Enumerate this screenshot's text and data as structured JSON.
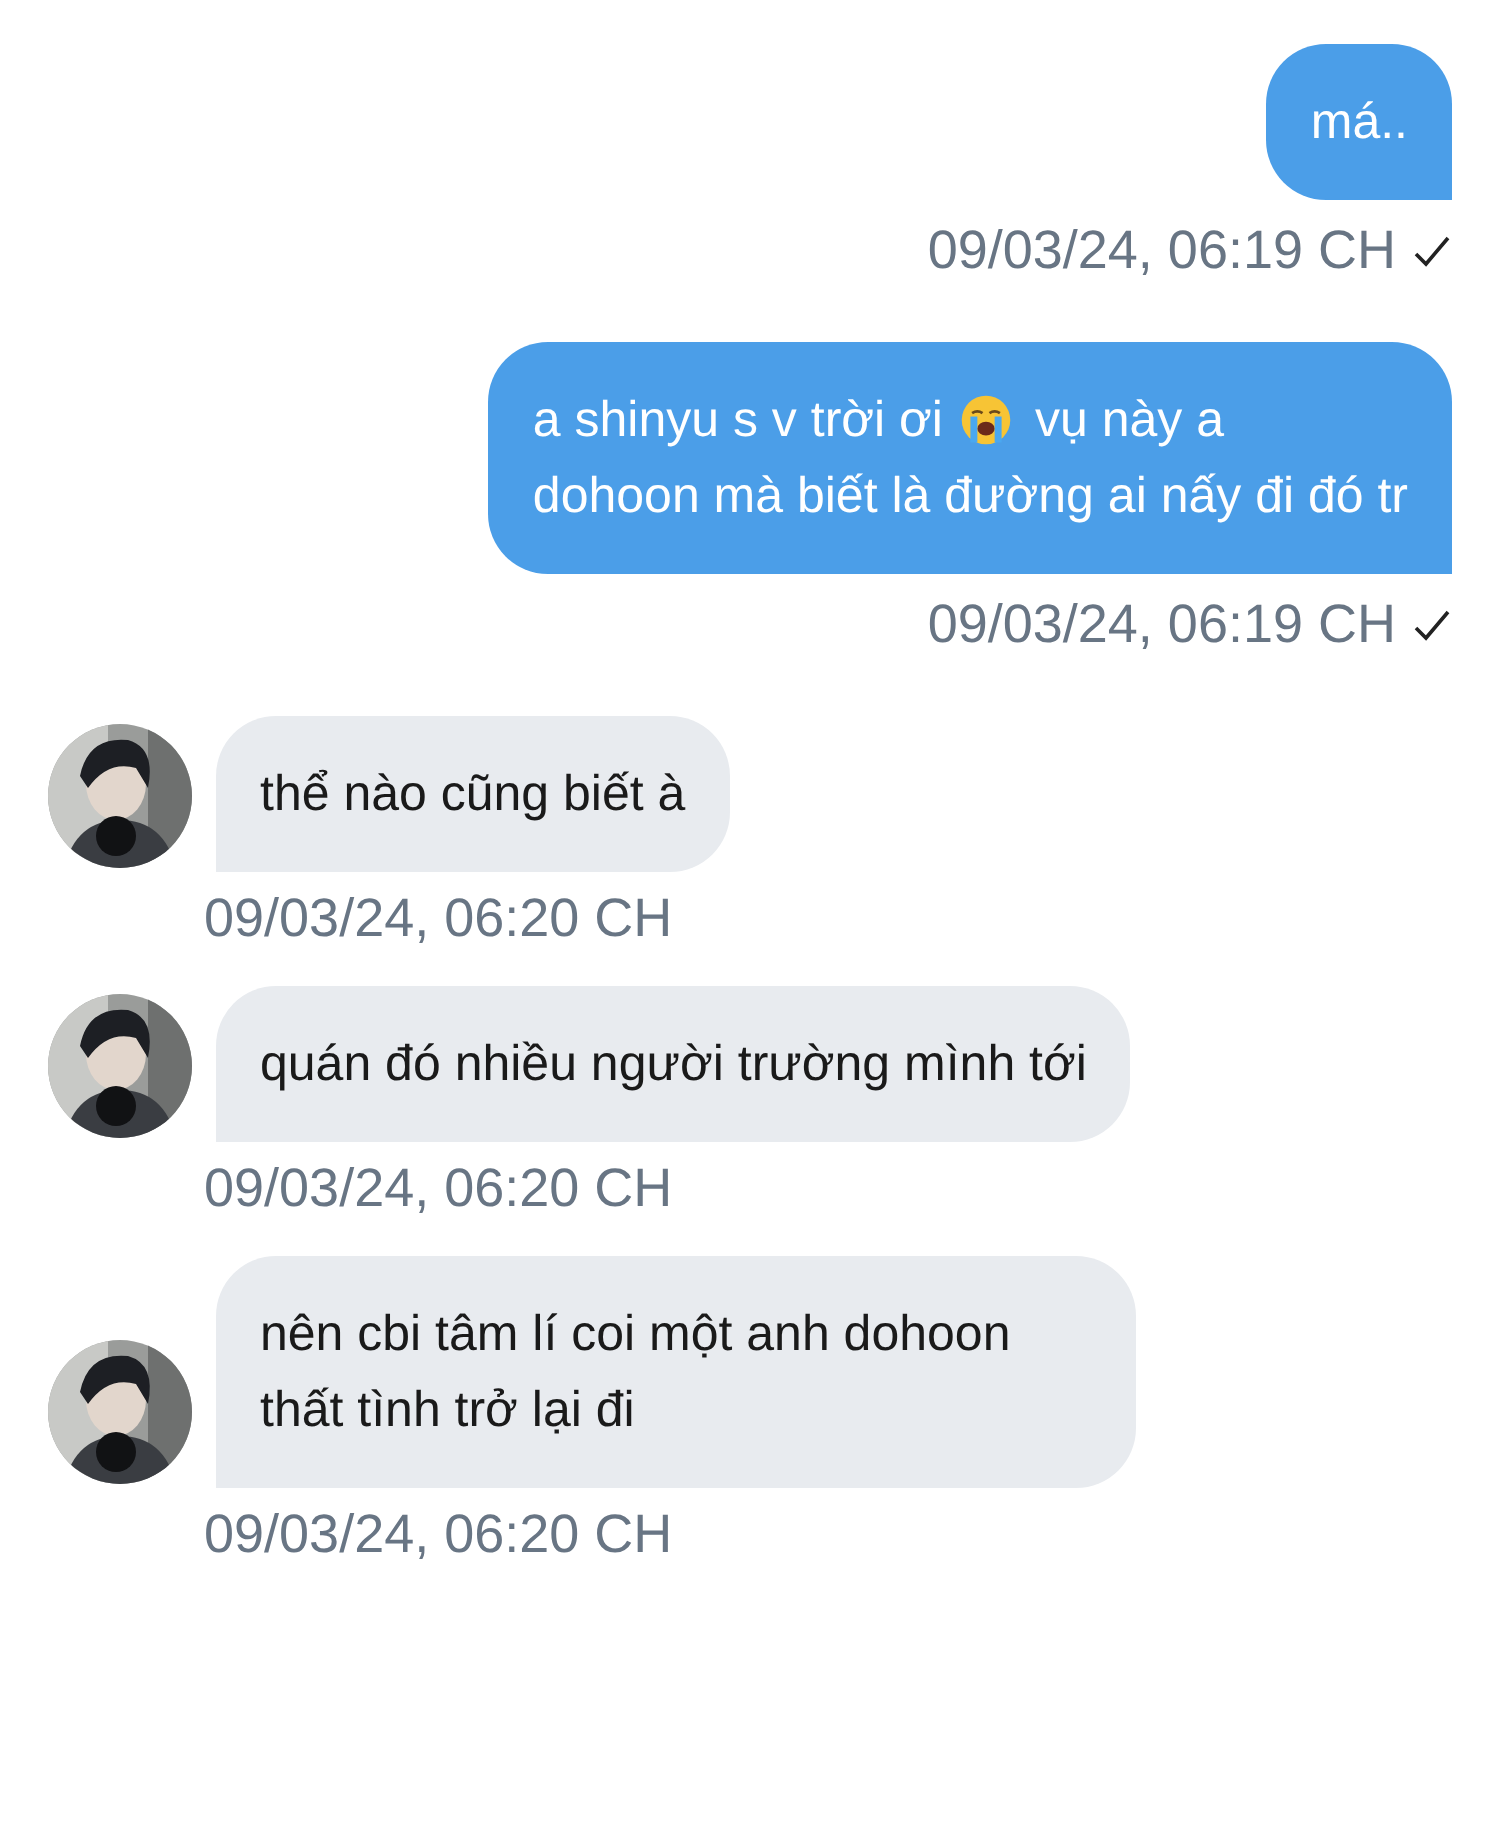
{
  "messages": [
    {
      "outgoing": true,
      "parts": [
        {
          "kind": "text",
          "text": "má.."
        }
      ],
      "time": "09/03/24, 06:19 CH",
      "read": true
    },
    {
      "outgoing": true,
      "parts": [
        {
          "kind": "text",
          "text": "a shinyu s v trời ơi"
        },
        {
          "kind": "emoji"
        },
        {
          "kind": "text",
          "text": "vụ này a"
        },
        {
          "kind": "para",
          "text": "dohoon mà biết là đường ai nấy đi đó tr"
        }
      ],
      "time": "09/03/24, 06:19 CH",
      "read": true
    },
    {
      "outgoing": false,
      "parts": [
        {
          "kind": "para",
          "text": "thể nào cũng biết à"
        }
      ],
      "time": "09/03/24, 06:20 CH"
    },
    {
      "outgoing": false,
      "parts": [
        {
          "kind": "para",
          "text": "quán đó nhiều người trường mình tới"
        }
      ],
      "time": "09/03/24, 06:20 CH"
    },
    {
      "outgoing": false,
      "parts": [
        {
          "kind": "para",
          "text": "nên cbi tâm lí coi một anh dohoon thất tình trở lại đi"
        }
      ],
      "time": "09/03/24, 06:20 CH"
    }
  ]
}
